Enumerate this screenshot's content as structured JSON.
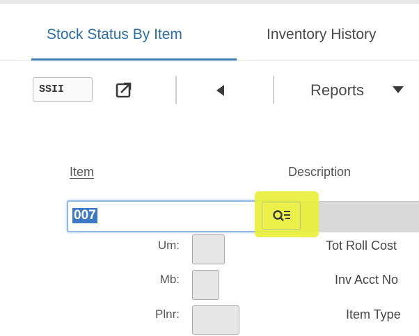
{
  "tabs": [
    {
      "label": "Stock Status By Item",
      "active": true
    },
    {
      "label": "Inventory History",
      "active": false
    }
  ],
  "toolbar": {
    "code": "SSII",
    "reports_label": "Reports"
  },
  "form": {
    "item_header": "Item",
    "description_header": "Description",
    "item_value": "007",
    "fields_left": [
      {
        "label": "Um:"
      },
      {
        "label": "Mb:"
      },
      {
        "label": "Plnr:"
      }
    ],
    "fields_right": [
      {
        "label": "Tot Roll Cost"
      },
      {
        "label": "Inv Acct No"
      },
      {
        "label": "Item Type"
      }
    ]
  },
  "colors": {
    "accent": "#3a7fb8",
    "highlight": "#e9f03a",
    "selection": "#3d78c4"
  }
}
